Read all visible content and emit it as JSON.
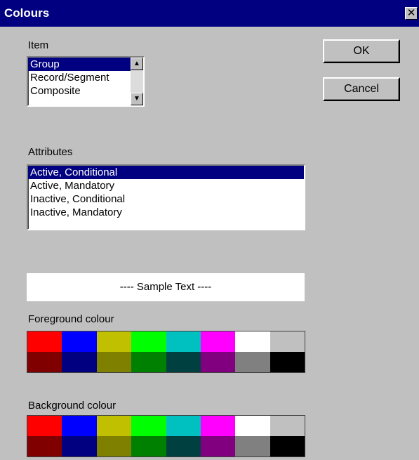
{
  "window": {
    "title": "Colours",
    "close_glyph": "✕"
  },
  "item": {
    "label": "Item",
    "options": [
      "Group",
      "Record/Segment",
      "Composite"
    ],
    "selected_index": 0,
    "scroll_up_glyph": "▲",
    "scroll_down_glyph": "▼"
  },
  "buttons": {
    "ok": "OK",
    "cancel": "Cancel"
  },
  "attributes": {
    "label": "Attributes",
    "options": [
      "Active, Conditional",
      "Active, Mandatory",
      "Inactive, Conditional",
      "Inactive, Mandatory"
    ],
    "selected_index": 0
  },
  "sample_text": "---- Sample Text ----",
  "foreground": {
    "label": "Foreground colour",
    "colors": [
      "#ff0000",
      "#0000ff",
      "#c0c000",
      "#00ff00",
      "#00c0c0",
      "#ff00ff",
      "#ffffff",
      "#c0c0c0",
      "#800000",
      "#000080",
      "#808000",
      "#008000",
      "#004040",
      "#800080",
      "#808080",
      "#000000"
    ]
  },
  "background": {
    "label": "Background colour",
    "colors": [
      "#ff0000",
      "#0000ff",
      "#c0c000",
      "#00ff00",
      "#00c0c0",
      "#ff00ff",
      "#ffffff",
      "#c0c0c0",
      "#800000",
      "#000080",
      "#808000",
      "#008000",
      "#004040",
      "#800080",
      "#808080",
      "#000000"
    ]
  }
}
